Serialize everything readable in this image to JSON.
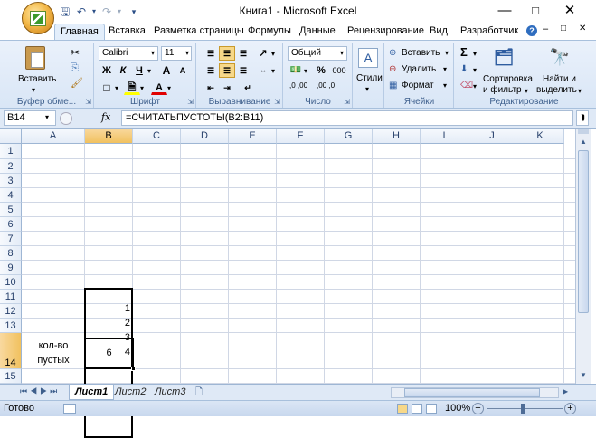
{
  "window": {
    "title": "Книга1 - Microsoft Excel"
  },
  "tabs": [
    "Главная",
    "Вставка",
    "Разметка страницы",
    "Формулы",
    "Данные",
    "Рецензирование",
    "Вид",
    "Разработчик"
  ],
  "ribbon": {
    "clipboard": {
      "paste": "Вставить",
      "label": "Буфер обме..."
    },
    "font": {
      "name": "Calibri",
      "size": "11",
      "bold": "Ж",
      "italic": "К",
      "underline": "Ч",
      "grow": "A",
      "shrink": "A",
      "label": "Шрифт"
    },
    "alignment": {
      "label": "Выравнивание"
    },
    "number": {
      "format": "Общий",
      "percent": "%",
      "thousands": "000",
      "inc": ",0 ,00",
      "dec": ",00 ,0",
      "label": "Число"
    },
    "styles": {
      "label": "Стили"
    },
    "cells": {
      "insert": "Вставить",
      "delete": "Удалить",
      "format": "Формат",
      "label": "Ячейки"
    },
    "editing": {
      "sigma": "Σ",
      "sort": "Сортировка",
      "sort2": "и фильтр",
      "find": "Найти и",
      "find2": "выделить",
      "label": "Редактирование"
    }
  },
  "formula_bar": {
    "cell_ref": "B14",
    "fx": "fx",
    "formula": "=СЧИТАТЬПУСТОТЫ(B2:B11)"
  },
  "columns": [
    "A",
    "B",
    "C",
    "D",
    "E",
    "F",
    "G",
    "H",
    "I",
    "J",
    "K"
  ],
  "rows": [
    "1",
    "2",
    "3",
    "4",
    "5",
    "6",
    "7",
    "8",
    "9",
    "10",
    "11",
    "12",
    "13",
    "14",
    "15"
  ],
  "cells": {
    "B3": "1",
    "B4": "2",
    "B5": "3",
    "B6": "4",
    "A14_line1": "кол-во",
    "A14_line2": "пустых",
    "B14": "6"
  },
  "sheets": [
    "Лист1",
    "Лист2",
    "Лист3"
  ],
  "status": {
    "ready": "Готово",
    "zoom": "100%"
  }
}
